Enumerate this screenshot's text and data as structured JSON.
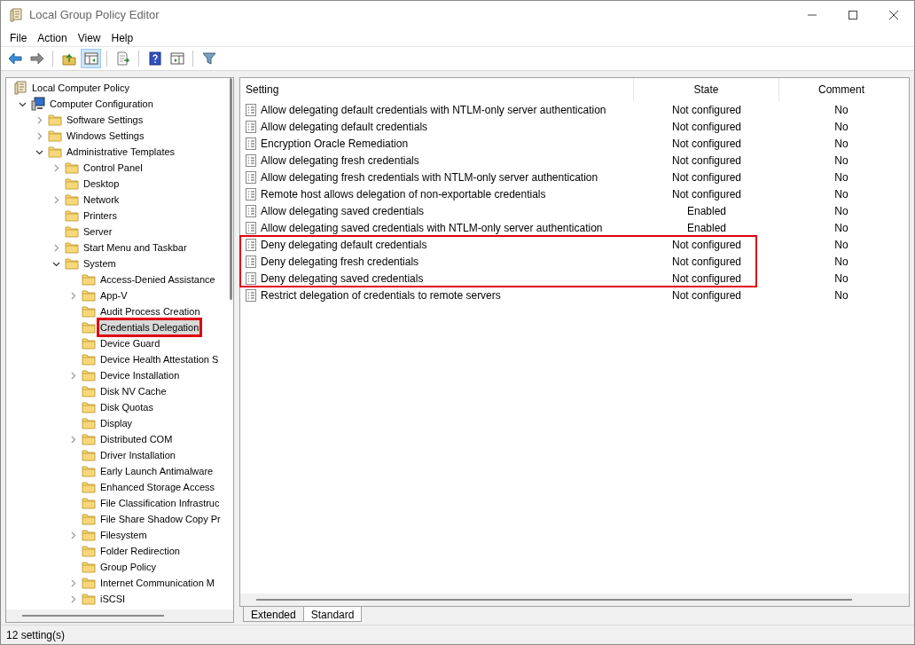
{
  "window": {
    "title": "Local Group Policy Editor"
  },
  "menu": [
    "File",
    "Action",
    "View",
    "Help"
  ],
  "toolbar": [
    {
      "kind": "back",
      "pressed": false
    },
    {
      "kind": "forward",
      "pressed": false
    },
    {
      "kind": "sep"
    },
    {
      "kind": "up",
      "pressed": false
    },
    {
      "kind": "tree",
      "pressed": true
    },
    {
      "kind": "sep"
    },
    {
      "kind": "export",
      "pressed": false
    },
    {
      "kind": "sep"
    },
    {
      "kind": "help",
      "pressed": false
    },
    {
      "kind": "pane",
      "pressed": false
    },
    {
      "kind": "sep"
    },
    {
      "kind": "filter",
      "pressed": false
    }
  ],
  "tree": [
    {
      "label": "Local Computer Policy",
      "selected": false,
      "boxed": false,
      "children": [
        {
          "label": "Computer Configuration",
          "expanded": true,
          "selected": false,
          "boxed": false,
          "children": [
            {
              "label": "Software Settings",
              "expanded": false,
              "selected": false,
              "boxed": false
            },
            {
              "label": "Windows Settings",
              "expanded": false,
              "selected": false,
              "boxed": false
            },
            {
              "label": "Administrative Templates",
              "expanded": true,
              "selected": false,
              "boxed": false,
              "children": [
                {
                  "label": "Control Panel",
                  "expanded": false,
                  "selected": false,
                  "boxed": false
                },
                {
                  "label": "Desktop",
                  "selected": false,
                  "boxed": false
                },
                {
                  "label": "Network",
                  "expanded": false,
                  "selected": false,
                  "boxed": false
                },
                {
                  "label": "Printers",
                  "selected": false,
                  "boxed": false
                },
                {
                  "label": "Server",
                  "selected": false,
                  "boxed": false
                },
                {
                  "label": "Start Menu and Taskbar",
                  "expanded": false,
                  "selected": false,
                  "boxed": false
                },
                {
                  "label": "System",
                  "expanded": true,
                  "selected": false,
                  "boxed": false,
                  "children": [
                    {
                      "label": "Access-Denied Assistance",
                      "selected": false,
                      "boxed": false
                    },
                    {
                      "label": "App-V",
                      "expanded": false,
                      "selected": false,
                      "boxed": false
                    },
                    {
                      "label": "Audit Process Creation",
                      "selected": false,
                      "boxed": false
                    },
                    {
                      "label": "Credentials Delegation",
                      "selected": true,
                      "boxed": true
                    },
                    {
                      "label": "Device Guard",
                      "selected": false,
                      "boxed": false
                    },
                    {
                      "label": "Device Health Attestation S",
                      "selected": false,
                      "boxed": false
                    },
                    {
                      "label": "Device Installation",
                      "expanded": false,
                      "selected": false,
                      "boxed": false
                    },
                    {
                      "label": "Disk NV Cache",
                      "selected": false,
                      "boxed": false
                    },
                    {
                      "label": "Disk Quotas",
                      "selected": false,
                      "boxed": false
                    },
                    {
                      "label": "Display",
                      "selected": false,
                      "boxed": false
                    },
                    {
                      "label": "Distributed COM",
                      "expanded": false,
                      "selected": false,
                      "boxed": false
                    },
                    {
                      "label": "Driver Installation",
                      "selected": false,
                      "boxed": false
                    },
                    {
                      "label": "Early Launch Antimalware",
                      "selected": false,
                      "boxed": false
                    },
                    {
                      "label": "Enhanced Storage Access",
                      "selected": false,
                      "boxed": false
                    },
                    {
                      "label": "File Classification Infrastruc",
                      "selected": false,
                      "boxed": false
                    },
                    {
                      "label": "File Share Shadow Copy Pr",
                      "selected": false,
                      "boxed": false
                    },
                    {
                      "label": "Filesystem",
                      "expanded": false,
                      "selected": false,
                      "boxed": false
                    },
                    {
                      "label": "Folder Redirection",
                      "selected": false,
                      "boxed": false
                    },
                    {
                      "label": "Group Policy",
                      "selected": false,
                      "boxed": false
                    },
                    {
                      "label": "Internet Communication M",
                      "expanded": false,
                      "selected": false,
                      "boxed": false
                    },
                    {
                      "label": "iSCSI",
                      "expanded": false,
                      "selected": false,
                      "boxed": false
                    }
                  ]
                }
              ]
            }
          ]
        }
      ]
    }
  ],
  "table": {
    "columns": [
      "Setting",
      "State",
      "Comment"
    ],
    "rows": [
      {
        "setting": "Allow delegating default credentials with NTLM-only server authentication",
        "state": "Not configured",
        "comment": "No",
        "boxed": false
      },
      {
        "setting": "Allow delegating default credentials",
        "state": "Not configured",
        "comment": "No",
        "boxed": false
      },
      {
        "setting": "Encryption Oracle Remediation",
        "state": "Not configured",
        "comment": "No",
        "boxed": false
      },
      {
        "setting": "Allow delegating fresh credentials",
        "state": "Not configured",
        "comment": "No",
        "boxed": false
      },
      {
        "setting": "Allow delegating fresh credentials with NTLM-only server authentication",
        "state": "Not configured",
        "comment": "No",
        "boxed": false
      },
      {
        "setting": "Remote host allows delegation of non-exportable credentials",
        "state": "Not configured",
        "comment": "No",
        "boxed": false
      },
      {
        "setting": "Allow delegating saved credentials",
        "state": "Enabled",
        "comment": "No",
        "boxed": false
      },
      {
        "setting": "Allow delegating saved credentials with NTLM-only server authentication",
        "state": "Enabled",
        "comment": "No",
        "boxed": false
      },
      {
        "setting": "Deny delegating default credentials",
        "state": "Not configured",
        "comment": "No",
        "boxed": true
      },
      {
        "setting": "Deny delegating fresh credentials",
        "state": "Not configured",
        "comment": "No",
        "boxed": true
      },
      {
        "setting": "Deny delegating saved credentials",
        "state": "Not configured",
        "comment": "No",
        "boxed": true
      },
      {
        "setting": "Restrict delegation of credentials to remote servers",
        "state": "Not configured",
        "comment": "No",
        "boxed": false
      }
    ]
  },
  "view_tabs": [
    {
      "label": "Extended",
      "selected": false
    },
    {
      "label": "Standard",
      "selected": true
    }
  ],
  "status_bar": "12 setting(s)"
}
